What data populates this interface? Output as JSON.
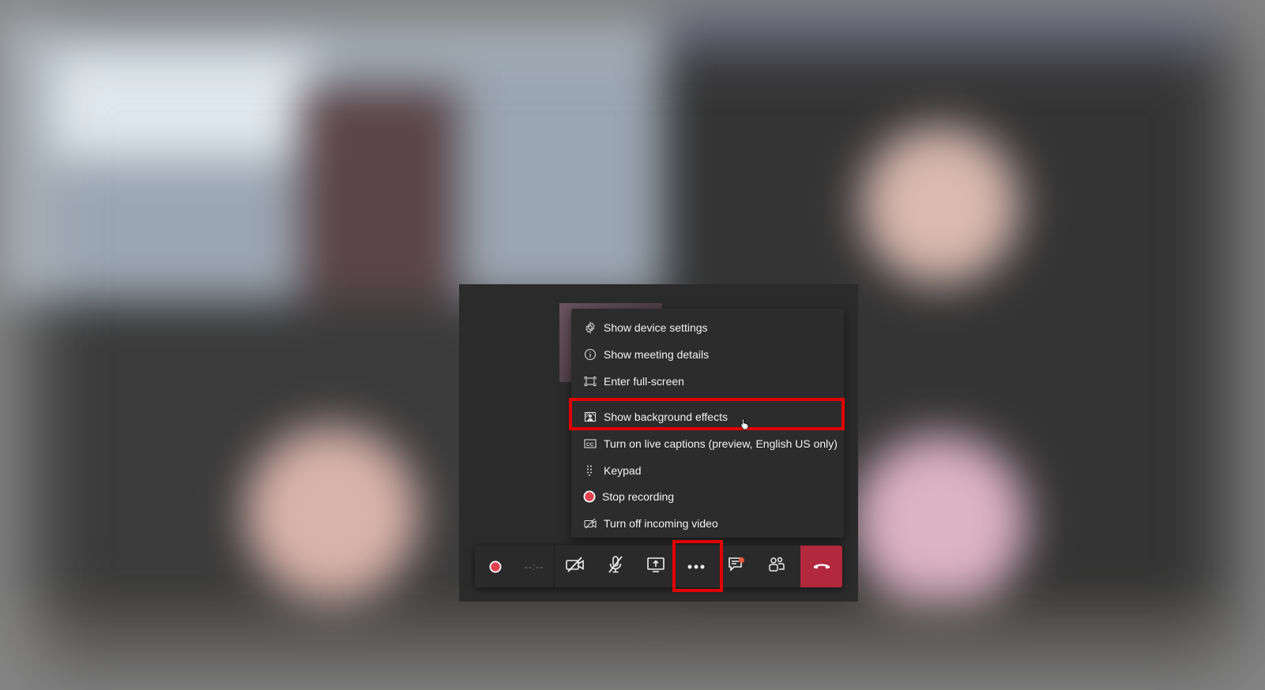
{
  "menu": {
    "items": [
      {
        "label": "Show device settings",
        "icon": "gear-icon"
      },
      {
        "label": "Show meeting details",
        "icon": "info-icon"
      },
      {
        "label": "Enter full-screen",
        "icon": "fullscreen-icon"
      },
      {
        "label": "Show background effects",
        "icon": "background-effects-icon"
      },
      {
        "label": "Turn on live captions (preview, English US only)",
        "icon": "cc-icon"
      },
      {
        "label": "Keypad",
        "icon": "keypad-icon"
      },
      {
        "label": "Stop recording",
        "icon": "record-icon"
      },
      {
        "label": "Turn off incoming video",
        "icon": "video-off-icon"
      }
    ]
  },
  "control_bar": {
    "timer": "--:--",
    "buttons": [
      "record-indicator",
      "camera-off",
      "mic-off",
      "share-screen",
      "more-actions",
      "chat",
      "participants",
      "hang-up"
    ]
  },
  "colors": {
    "highlight": "#e00000",
    "hangup": "#b2283c",
    "record": "#e0434f",
    "notification": "#e8583b"
  }
}
